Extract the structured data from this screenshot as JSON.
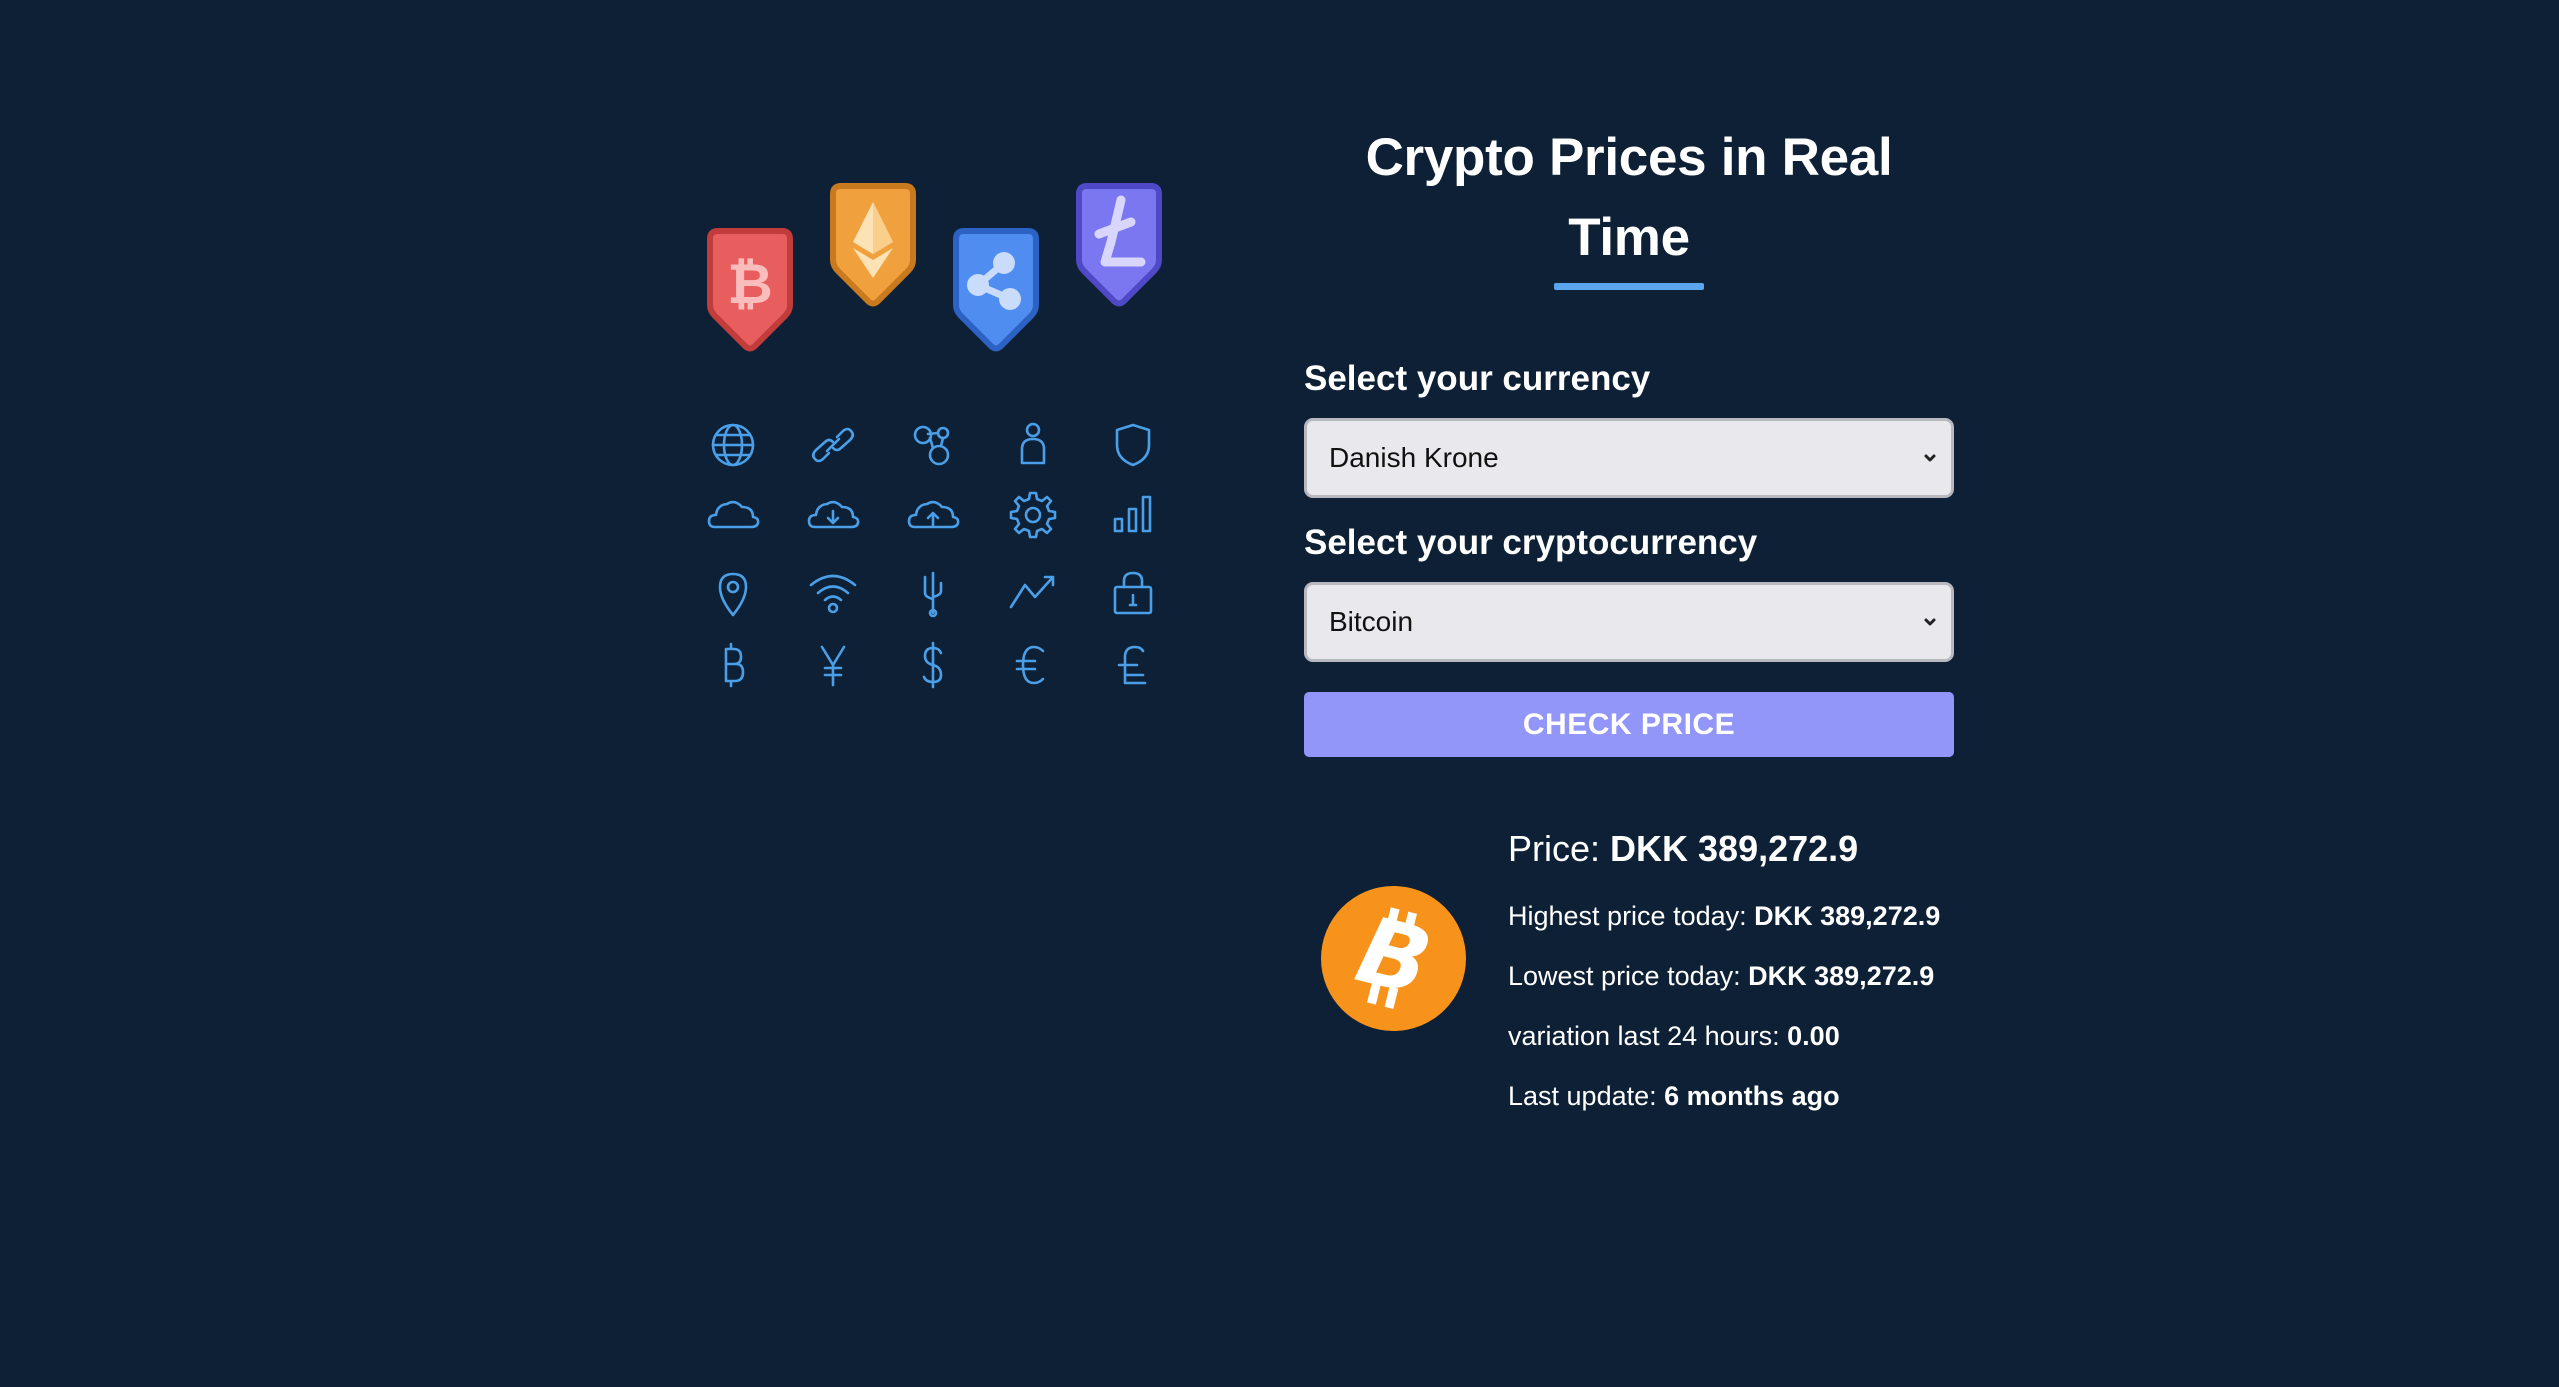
{
  "header": {
    "title": "Crypto Prices in Real Time"
  },
  "form": {
    "currency_label": "Select your currency",
    "currency_value": "Danish Krone",
    "crypto_label": "Select your cryptocurrency",
    "crypto_value": "Bitcoin",
    "button_label": "CHECK PRICE"
  },
  "result": {
    "price_label": "Price: ",
    "price_value": "DKK 389,272.9",
    "high_label": "Highest price today: ",
    "high_value": "DKK 389,272.9",
    "low_label": "Lowest price today: ",
    "low_value": "DKK 389,272.9",
    "variation_label": "variation last 24 hours: ",
    "variation_value": "0.00",
    "update_label": "Last update: ",
    "update_value": "6 months ago",
    "coin_icon": "bitcoin-coin-icon"
  },
  "illustration": {
    "shields": [
      "bitcoin-shield-icon",
      "ethereum-shield-icon",
      "ripple-shield-icon",
      "litecoin-shield-icon"
    ],
    "icons": [
      "globe-icon",
      "chain-link-icon",
      "nodes-icon",
      "user-icon",
      "shield-icon",
      "cloud-icon",
      "cloud-download-icon",
      "cloud-upload-icon",
      "gear-icon",
      "bar-chart-icon",
      "location-pin-icon",
      "wifi-icon",
      "usb-icon",
      "trend-up-icon",
      "lock-icon",
      "bitcoin-sign-icon",
      "yen-sign-icon",
      "dollar-sign-icon",
      "euro-sign-icon",
      "pound-sign-icon"
    ]
  },
  "colors": {
    "background": "#0d2035",
    "accent": "#5aa5ee",
    "button": "#9196f8",
    "icon_stroke": "#4a9fe8",
    "bitcoin_orange": "#f7931a"
  }
}
